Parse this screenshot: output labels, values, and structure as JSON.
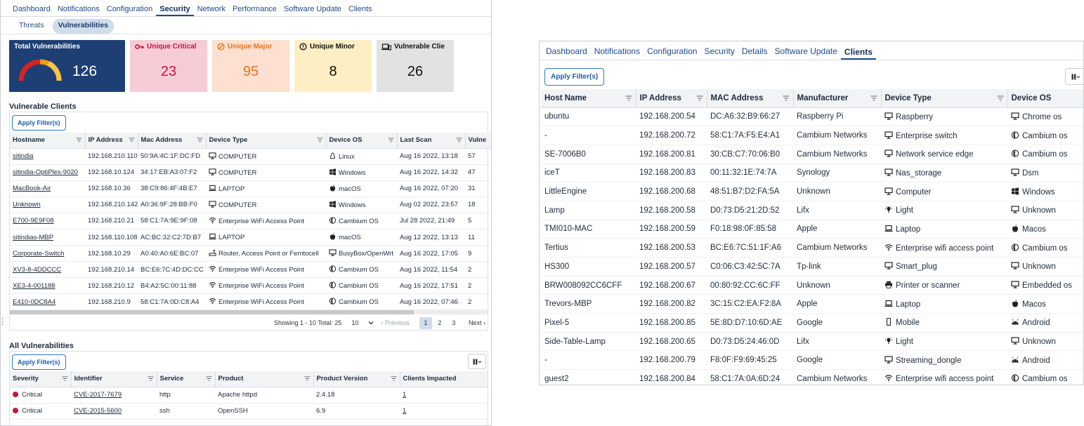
{
  "left": {
    "nav": [
      "Dashboard",
      "Notifications",
      "Configuration",
      "Security",
      "Network",
      "Performance",
      "Software Update",
      "Clients"
    ],
    "nav_active": 3,
    "subtabs": [
      "Threats",
      "Vulnerabilities"
    ],
    "subtab_active": 1,
    "cards": {
      "total": {
        "title": "Total Vulnerabilities",
        "value": "126"
      },
      "critical": {
        "title": "Unique Critical",
        "value": "23"
      },
      "major": {
        "title": "Unique Major",
        "value": "95"
      },
      "minor": {
        "title": "Unique Minor",
        "value": "8"
      },
      "vulnerable": {
        "title": "Vulnerable Clie",
        "value": "26"
      }
    },
    "vulnerable_clients": {
      "title": "Vulnerable Clients",
      "apply_label": "Apply Filter(s)",
      "columns": [
        "Hostname",
        "IP Address",
        "Mac Address",
        "Device Type",
        "Device OS",
        "Last Scan",
        "Vulne"
      ],
      "rows": [
        {
          "host": "sitindia",
          "ip": "192.168.210.110",
          "mac": "50:9A:4C:1F:DC:FD",
          "type": "COMPUTER",
          "type_icon": "computer-icon",
          "os": "Linux",
          "os_icon": "linux-icon",
          "scan": "Aug 16 2022, 13:18",
          "vuln": "57"
        },
        {
          "host": "sitindia-OptiPlex-9020",
          "ip": "192.168.10.124",
          "mac": "34:17:EB:A3:07:F2",
          "type": "COMPUTER",
          "type_icon": "computer-icon",
          "os": "Windows",
          "os_icon": "windows-icon",
          "scan": "Aug 16 2022, 14:32",
          "vuln": "47"
        },
        {
          "host": "MacBook-Air",
          "ip": "192.168.10.36",
          "mac": "38:C9:86:4F:4B:E7",
          "type": "LAPTOP",
          "type_icon": "laptop-icon",
          "os": "macOS",
          "os_icon": "apple-icon",
          "scan": "Aug 16 2022, 07:20",
          "vuln": "31"
        },
        {
          "host": "Unknown",
          "ip": "192.168.210.142",
          "mac": "A0:36:9F:28:BB:F0",
          "type": "COMPUTER",
          "type_icon": "computer-icon",
          "os": "Windows",
          "os_icon": "windows-icon",
          "scan": "Aug 02 2022, 23:57",
          "vuln": "18"
        },
        {
          "host": "E700-9E9F08",
          "ip": "192.168.210.21",
          "mac": "58:C1:7A:9E:9F:08",
          "type": "Enterprise WiFi Access Point",
          "type_icon": "wifi-icon",
          "os": "Cambium OS",
          "os_icon": "cambium-icon",
          "scan": "Jul 28 2022, 21:49",
          "vuln": "5"
        },
        {
          "host": "sitindias-MBP",
          "ip": "192.168.110.108",
          "mac": "AC:BC:32:C2:7D:B7",
          "type": "LAPTOP",
          "type_icon": "laptop-icon",
          "os": "macOS",
          "os_icon": "apple-icon",
          "scan": "Aug 12 2022, 13:13",
          "vuln": "11"
        },
        {
          "host": "Corporate-Switch",
          "ip": "192.168.10.29",
          "mac": "A0:40:A0:6E:BC:07",
          "type": "Router, Access Point or Femtocell",
          "type_icon": "router-icon",
          "os": "BusyBox/OpenWrt",
          "os_icon": "monitor-icon",
          "scan": "Aug 16 2022, 17:05",
          "vuln": "9"
        },
        {
          "host": "XV3-8-4DDCCC",
          "ip": "192.168.210.14",
          "mac": "BC:E6:7C:4D:DC:CC",
          "type": "Enterprise WiFi Access Point",
          "type_icon": "wifi-icon",
          "os": "Cambium OS",
          "os_icon": "cambium-icon",
          "scan": "Aug 16 2022, 11:54",
          "vuln": "2"
        },
        {
          "host": "XE3-4-001188",
          "ip": "192.168.210.12",
          "mac": "B4:A2:5C:00:11:88",
          "type": "Enterprise WiFi Access Point",
          "type_icon": "wifi-icon",
          "os": "Cambium OS",
          "os_icon": "cambium-icon",
          "scan": "Aug 16 2022, 17:51",
          "vuln": "2"
        },
        {
          "host": "E410-0DC8A4",
          "ip": "192.168.210.9",
          "mac": "58:C1:7A:0D:C8:A4",
          "type": "Enterprise WiFi Access Point",
          "type_icon": "wifi-icon",
          "os": "Cambium OS",
          "os_icon": "cambium-icon",
          "scan": "Aug 16 2022, 07:46",
          "vuln": "2"
        }
      ],
      "pager": {
        "info": "Showing 1 - 10 Total: 25",
        "page_size": "10",
        "prev": "‹ Previous",
        "pages": [
          "1",
          "2",
          "3"
        ],
        "next": "Next ›"
      }
    },
    "all_vulnerabilities": {
      "title": "All Vulnerabilities",
      "apply_label": "Apply Filter(s)",
      "columns": [
        "Severity",
        "Identifier",
        "Service",
        "Product",
        "Product Version",
        "Clients Impacted"
      ],
      "rows": [
        {
          "severity": "Critical",
          "id": "CVE-2017-7679",
          "service": "http",
          "product": "Apache httpd",
          "version": "2.4.18",
          "impacted": "1"
        },
        {
          "severity": "Critical",
          "id": "CVE-2015-5600",
          "service": "ssh",
          "product": "OpenSSH",
          "version": "6.9",
          "impacted": "1"
        }
      ]
    }
  },
  "right": {
    "nav": [
      "Dashboard",
      "Notifications",
      "Configuration",
      "Security",
      "Details",
      "Software Update",
      "Clients"
    ],
    "nav_active": 6,
    "apply_label": "Apply Filter(s)",
    "columns": [
      "Host Name",
      "IP Address",
      "MAC Address",
      "Manufacturer",
      "Device Type",
      "Device OS"
    ],
    "rows": [
      {
        "host": "ubuntu",
        "ip": "192.168.200.54",
        "mac": "DC:A6:32:B9:66:27",
        "mfr": "Raspberry Pi",
        "type": "Raspberry",
        "type_icon": "monitor-icon",
        "os": "Chrome os",
        "os_icon": "monitor-icon"
      },
      {
        "host": "-",
        "ip": "192.168.200.72",
        "mac": "58:C1:7A:F5:E4:A1",
        "mfr": "Cambium Networks",
        "type": "Enterprise switch",
        "type_icon": "monitor-icon",
        "os": "Cambium os",
        "os_icon": "cambium-icon"
      },
      {
        "host": "SE-7006B0",
        "ip": "192.168.200.81",
        "mac": "30:CB:C7:70:06:B0",
        "mfr": "Cambium Networks",
        "type": "Network service edge",
        "type_icon": "monitor-icon",
        "os": "Cambium os",
        "os_icon": "cambium-icon"
      },
      {
        "host": "iceT",
        "ip": "192.168.200.83",
        "mac": "00:11:32:1E:74:7A",
        "mfr": "Synology",
        "type": "Nas_storage",
        "type_icon": "monitor-icon",
        "os": "Dsm",
        "os_icon": "monitor-icon"
      },
      {
        "host": "LittleEngine",
        "ip": "192.168.200.68",
        "mac": "48:51:B7:D2:FA:5A",
        "mfr": "Unknown",
        "type": "Computer",
        "type_icon": "monitor-icon",
        "os": "Windows",
        "os_icon": "windows-icon"
      },
      {
        "host": "Lamp",
        "ip": "192.168.200.58",
        "mac": "D0:73:D5:21:2D:52",
        "mfr": "Lifx",
        "type": "Light",
        "type_icon": "light-icon",
        "os": "Unknown",
        "os_icon": "monitor-icon"
      },
      {
        "host": "TMI010-MAC",
        "ip": "192.168.200.59",
        "mac": "F0:18:98:0F:85:58",
        "mfr": "Apple",
        "type": "Laptop",
        "type_icon": "laptop-icon",
        "os": "Macos",
        "os_icon": "apple-icon"
      },
      {
        "host": "Tertius",
        "ip": "192.168.200.53",
        "mac": "BC:E6:7C:51:1F:A6",
        "mfr": "Cambium Networks",
        "type": "Enterprise wifi access point",
        "type_icon": "wifi-icon",
        "os": "Cambium os",
        "os_icon": "cambium-icon"
      },
      {
        "host": "HS300",
        "ip": "192.168.200.57",
        "mac": "C0:06:C3:42:5C:7A",
        "mfr": "Tp-link",
        "type": "Smart_plug",
        "type_icon": "monitor-icon",
        "os": "Unknown",
        "os_icon": "monitor-icon"
      },
      {
        "host": "BRW008092CC6CFF",
        "ip": "192.168.200.67",
        "mac": "00:80:92:CC:6C:FF",
        "mfr": "Unknown",
        "type": "Printer or scanner",
        "type_icon": "printer-icon",
        "os": "Embedded os",
        "os_icon": "monitor-icon"
      },
      {
        "host": "Trevors-MBP",
        "ip": "192.168.200.82",
        "mac": "3C:15:C2:EA:F2:8A",
        "mfr": "Apple",
        "type": "Laptop",
        "type_icon": "laptop-icon",
        "os": "Macos",
        "os_icon": "apple-icon"
      },
      {
        "host": "Pixel-5",
        "ip": "192.168.200.85",
        "mac": "5E:8D:D7:10:6D:AE",
        "mfr": "Google",
        "type": "Mobile",
        "type_icon": "mobile-icon",
        "os": "Android",
        "os_icon": "android-icon"
      },
      {
        "host": "Side-Table-Lamp",
        "ip": "192.168.200.65",
        "mac": "D0:73:D5:24:46:0D",
        "mfr": "Lifx",
        "type": "Light",
        "type_icon": "light-icon",
        "os": "Unknown",
        "os_icon": "monitor-icon"
      },
      {
        "host": "-",
        "ip": "192.168.200.79",
        "mac": "F8:0F:F9:69:45:25",
        "mfr": "Google",
        "type": "Streaming_dongle",
        "type_icon": "monitor-icon",
        "os": "Android",
        "os_icon": "android-icon"
      },
      {
        "host": "guest2",
        "ip": "192.168.200.84",
        "mac": "58:C1:7A:0A:6D:24",
        "mfr": "Cambium Networks",
        "type": "Enterprise wifi access point",
        "type_icon": "wifi-icon",
        "os": "Cambium os",
        "os_icon": "cambium-icon"
      }
    ]
  },
  "colors": {
    "accent": "#1d4a8a",
    "total_card": "#1e3f74",
    "critical": "#c6163e",
    "major": "#e6731f",
    "minor_bg": "#fdefc3",
    "gauge_red": "#d6241f",
    "gauge_orange": "#f39a1d"
  }
}
